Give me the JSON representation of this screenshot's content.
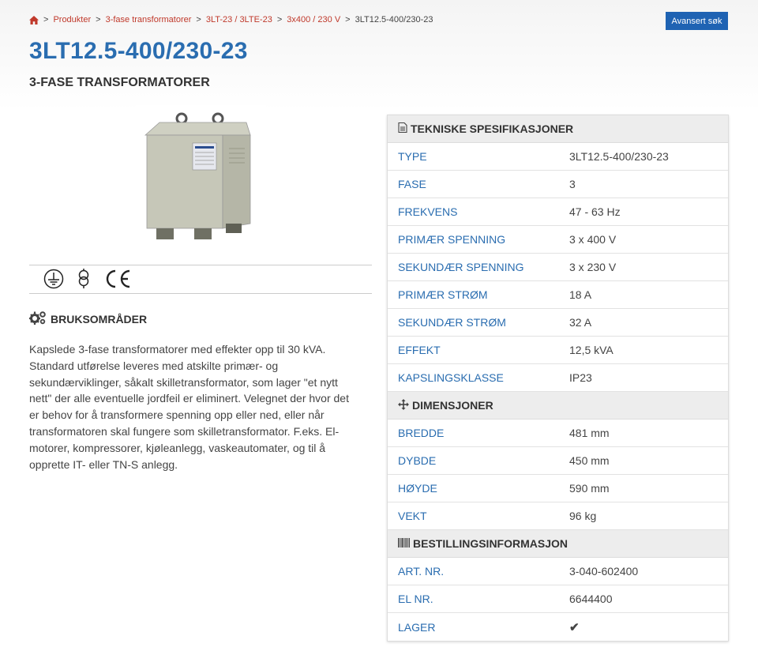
{
  "breadcrumb": {
    "items": [
      "Produkter",
      "3-fase transformatorer",
      "3LT-23 / 3LTE-23",
      "3x400 / 230 V"
    ],
    "current": "3LT12.5-400/230-23",
    "separator": ">"
  },
  "advanced_search_label": "Avansert søk",
  "page_title": "3LT12.5-400/230-23",
  "subtitle": "3-FASE TRANSFORMATORER",
  "usage": {
    "heading": "BRUKSOMRÅDER",
    "text": "Kapslede 3-fase transformatorer med effekter opp til 30 kVA. Standard utførelse leveres med atskilte primær- og sekundærviklinger, såkalt skilletransformator, som lager \"et nytt nett\" der alle eventuelle jordfeil er eliminert. Velegnet der hvor det er behov for å transformere spenning opp eller ned, eller når transformatoren skal fungere som skilletransformator. F.eks. El-motorer, kompressorer, kjøleanlegg, vaskeautomater, og til å opprette IT- eller TN-S anlegg."
  },
  "specs": {
    "technical": {
      "heading": "TEKNISKE SPESIFIKASJONER",
      "rows": [
        {
          "key": "TYPE",
          "value": "3LT12.5-400/230-23"
        },
        {
          "key": "FASE",
          "value": "3"
        },
        {
          "key": "FREKVENS",
          "value": "47 - 63 Hz"
        },
        {
          "key": "PRIMÆR SPENNING",
          "value": "3 x 400 V"
        },
        {
          "key": "SEKUNDÆR SPENNING",
          "value": "3 x 230 V"
        },
        {
          "key": "PRIMÆR STRØM",
          "value": "18 A"
        },
        {
          "key": "SEKUNDÆR STRØM",
          "value": "32 A"
        },
        {
          "key": "EFFEKT",
          "value": "12,5 kVA"
        },
        {
          "key": "KAPSLINGSKLASSE",
          "value": "IP23"
        }
      ]
    },
    "dimensions": {
      "heading": "DIMENSJONER",
      "rows": [
        {
          "key": "BREDDE",
          "value": "481 mm"
        },
        {
          "key": "DYBDE",
          "value": "450 mm"
        },
        {
          "key": "HØYDE",
          "value": "590 mm"
        },
        {
          "key": "VEKT",
          "value": "96 kg"
        }
      ]
    },
    "ordering": {
      "heading": "BESTILLINGSINFORMASJON",
      "rows": [
        {
          "key": "ART. NR.",
          "value": "3-040-602400"
        },
        {
          "key": "EL NR.",
          "value": "6644400"
        },
        {
          "key": "LAGER",
          "value": "✔"
        }
      ]
    }
  },
  "colors": {
    "accent": "#2a6db0",
    "breadcrumb_link": "#c0392b",
    "button": "#1f63b3",
    "in_stock": "#5cb82e"
  },
  "icons": [
    "home-icon",
    "document-icon",
    "move-arrows-icon",
    "barcode-icon",
    "gears-icon",
    "ground-symbol-icon",
    "isolation-transformer-icon",
    "ce-mark-icon",
    "checkmark-icon"
  ]
}
